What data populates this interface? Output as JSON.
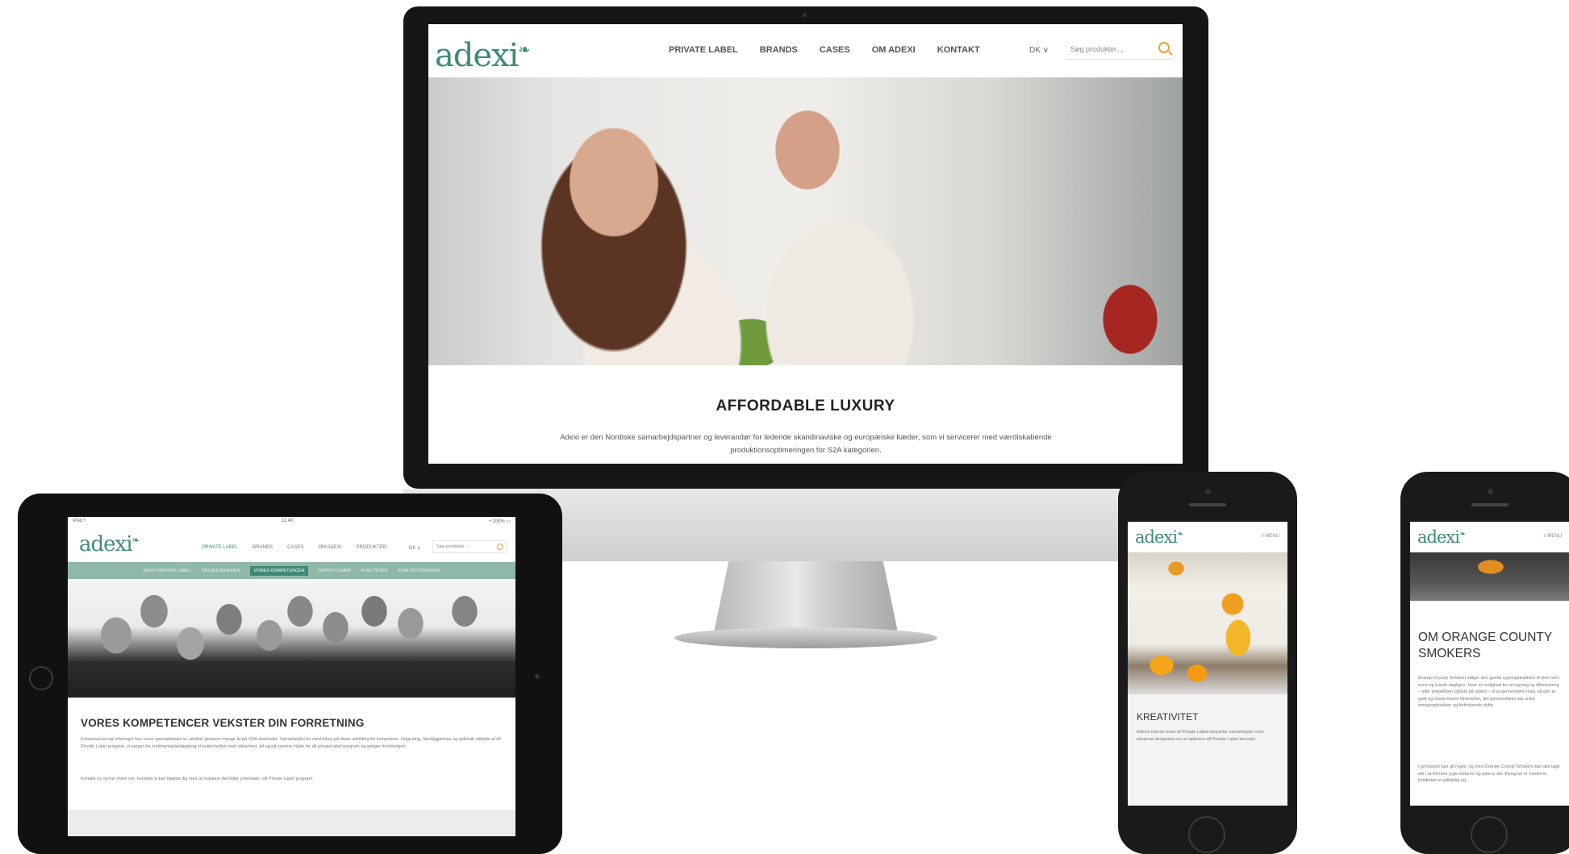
{
  "imac": {
    "logo": "adexi",
    "logo_mark": "❧",
    "menu": [
      "PRIVATE LABEL",
      "BRANDS",
      "CASES",
      "OM ADEXI",
      "KONTAKT"
    ],
    "lang": "DK ∨",
    "search_placeholder": "Søg produkter…",
    "headline": "AFFORDABLE LUXURY",
    "copy": "Adexi er den Nordiske samarbejdspartner og leverandør for ledende skandinaviske og europæiske kæder, som vi servicerer med værdiskabende produktionsoptimeringen for S2A kategorien."
  },
  "ipad": {
    "status_left": "iPad •",
    "status_center": "11:40",
    "status_right": "• 100% ▭",
    "logo": "adexi",
    "logo_mark": "❧",
    "menu": [
      "PRIVATE LABEL",
      "BRANDS",
      "CASES",
      "OM ADEXI",
      "PRODUKTER"
    ],
    "active_menu_index": 0,
    "lang": "DK ∨",
    "search_placeholder": "Søg produkter…",
    "submenu": [
      "ADEXI PRIVATE LABEL",
      "DIN MULIGHEDER",
      "VORES KOMPETENCER",
      "SUPPLY CHAIN",
      "KVALITETEN",
      "KVALITETSSIKRING"
    ],
    "active_submenu_index": 2,
    "headline": "VORES KOMPETENCER VEKSTER DIN FORRETNING",
    "copy": "Kompetencer og erfaringer hos vores specialisteam er udviklet gennem mange år på SDA-markedet. Samarbejdet du med fokus på disse udvikling for kompetens. Udgivning, færdiggjørelse og optimalt udbytte af dit Private Label program, vi sørger fra sortimentsplanlægning til butikshylden med sikkerhed, tid og på samme måde for dit private label program og sælger forretningen.",
    "copy2": "Kontakt os og hør mere om, hvordan vi kan hjælpe dig med at realisere det fulde potentiale i dit Private Label program."
  },
  "phone1": {
    "logo": "adexi",
    "logo_mark": "❧",
    "menu_label": "≡ MENU",
    "headline": "KREATIVITET",
    "copy": "Adexis interne team af Private Label-eksperter samarbejder med eksterne designere om at optimere dit Private Label koncept."
  },
  "phone2": {
    "logo": "adexi",
    "logo_mark": "❧",
    "menu_label": "≡ MENU",
    "headline": "OM ORANGE COUNTY SMOKERS",
    "copy": "Orange County Smokers følger den gamle rygningstradition til sine mini-ovne og kunde-dagliges. Hver er mulighed for at rygning og tilberedning – eller simpelthen ophold på udsnit – til at gennemføre mad, så den er godt og modernisere filmmedier, det gennemføres via unike smagsoplevelser og forfriskende dufte.",
    "copy2": "I princippet kan alt ryges, og med Orange County Smokers kan alle tage del i at fremme ryge-kulturen og opleve det. Designet er moderne, kvaliteten er pålidelig og..."
  }
}
